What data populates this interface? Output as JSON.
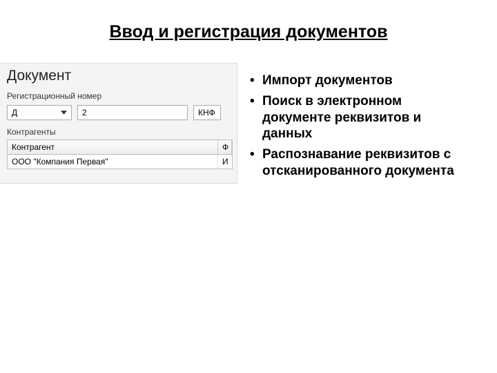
{
  "title": "Ввод и регистрация документов",
  "panel": {
    "heading": "Документ",
    "reg_label": "Регистрационный номер",
    "combo_value": "Д",
    "number_value": "2",
    "suffix_value": "КНФ",
    "counterparties_label": "Контрагенты",
    "grid": {
      "header_main": "Контрагент",
      "header_side": "Ф",
      "row_main": "ООО \"Компания Первая\"",
      "row_side": "И"
    }
  },
  "bullets": [
    "Импорт документов",
    "Поиск в электронном документе реквизитов и данных",
    "Распознавание реквизитов с отсканированного документа"
  ]
}
